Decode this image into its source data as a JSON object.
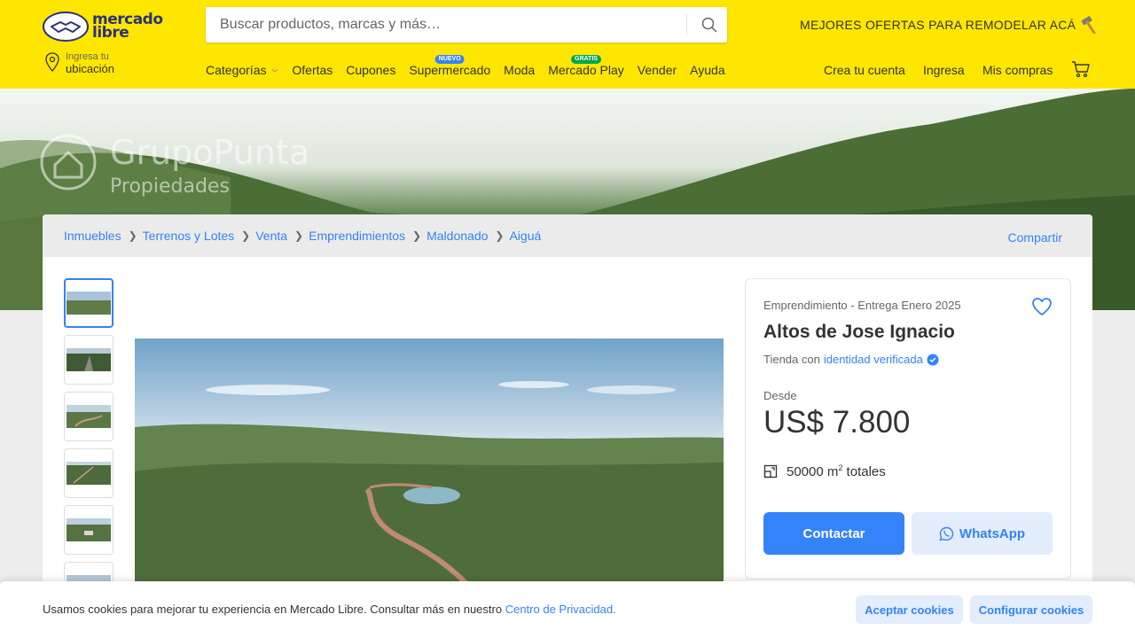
{
  "header": {
    "logo_line1": "mercado",
    "logo_line2": "libre",
    "search_placeholder": "Buscar productos, marcas y más…",
    "promo": "MEJORES OFERTAS PARA REMODELAR ACÁ",
    "location_small": "Ingresa tu",
    "location_big": "ubicación",
    "nav": [
      {
        "label": "Categorías"
      },
      {
        "label": "Ofertas"
      },
      {
        "label": "Cupones"
      },
      {
        "label": "Supermercado",
        "badge": "NUEVO",
        "badge_color": "#3483fa"
      },
      {
        "label": "Moda"
      },
      {
        "label": "Mercado Play",
        "badge": "GRATIS",
        "badge_color": "#00a650"
      },
      {
        "label": "Vender"
      },
      {
        "label": "Ayuda"
      }
    ],
    "account": {
      "create": "Crea tu cuenta",
      "login": "Ingresa",
      "purchases": "Mis compras"
    }
  },
  "hero": {
    "watermark_title": "GrupoPunta",
    "watermark_sub": "Propiedades"
  },
  "breadcrumb": {
    "items": [
      "Inmuebles",
      "Terrenos y Lotes",
      "Venta",
      "Emprendimientos",
      "Maldonado",
      "Aiguá"
    ],
    "share": "Compartir"
  },
  "gallery": {
    "thumb_count": 6
  },
  "listing": {
    "subtitle": "Emprendimiento - Entrega Enero 2025",
    "title": "Altos de Jose Ignacio",
    "seller_prefix": "Tienda con",
    "seller_link": "identidad verificada",
    "from_label": "Desde",
    "price": "US$ 7.800",
    "area_value": "50000 m",
    "area_sup": "2",
    "area_suffix": " totales",
    "contact_label": "Contactar",
    "whatsapp_label": "WhatsApp"
  },
  "cookie": {
    "text": "Usamos cookies para mejorar tu experiencia en Mercado Libre. Consultar más en nuestro ",
    "link": "Centro de Privacidad.",
    "accept": "Aceptar cookies",
    "configure": "Configurar cookies"
  },
  "colors": {
    "brand_yellow": "#ffe600",
    "accent_blue": "#3483fa",
    "logo_navy": "#2d3277"
  }
}
